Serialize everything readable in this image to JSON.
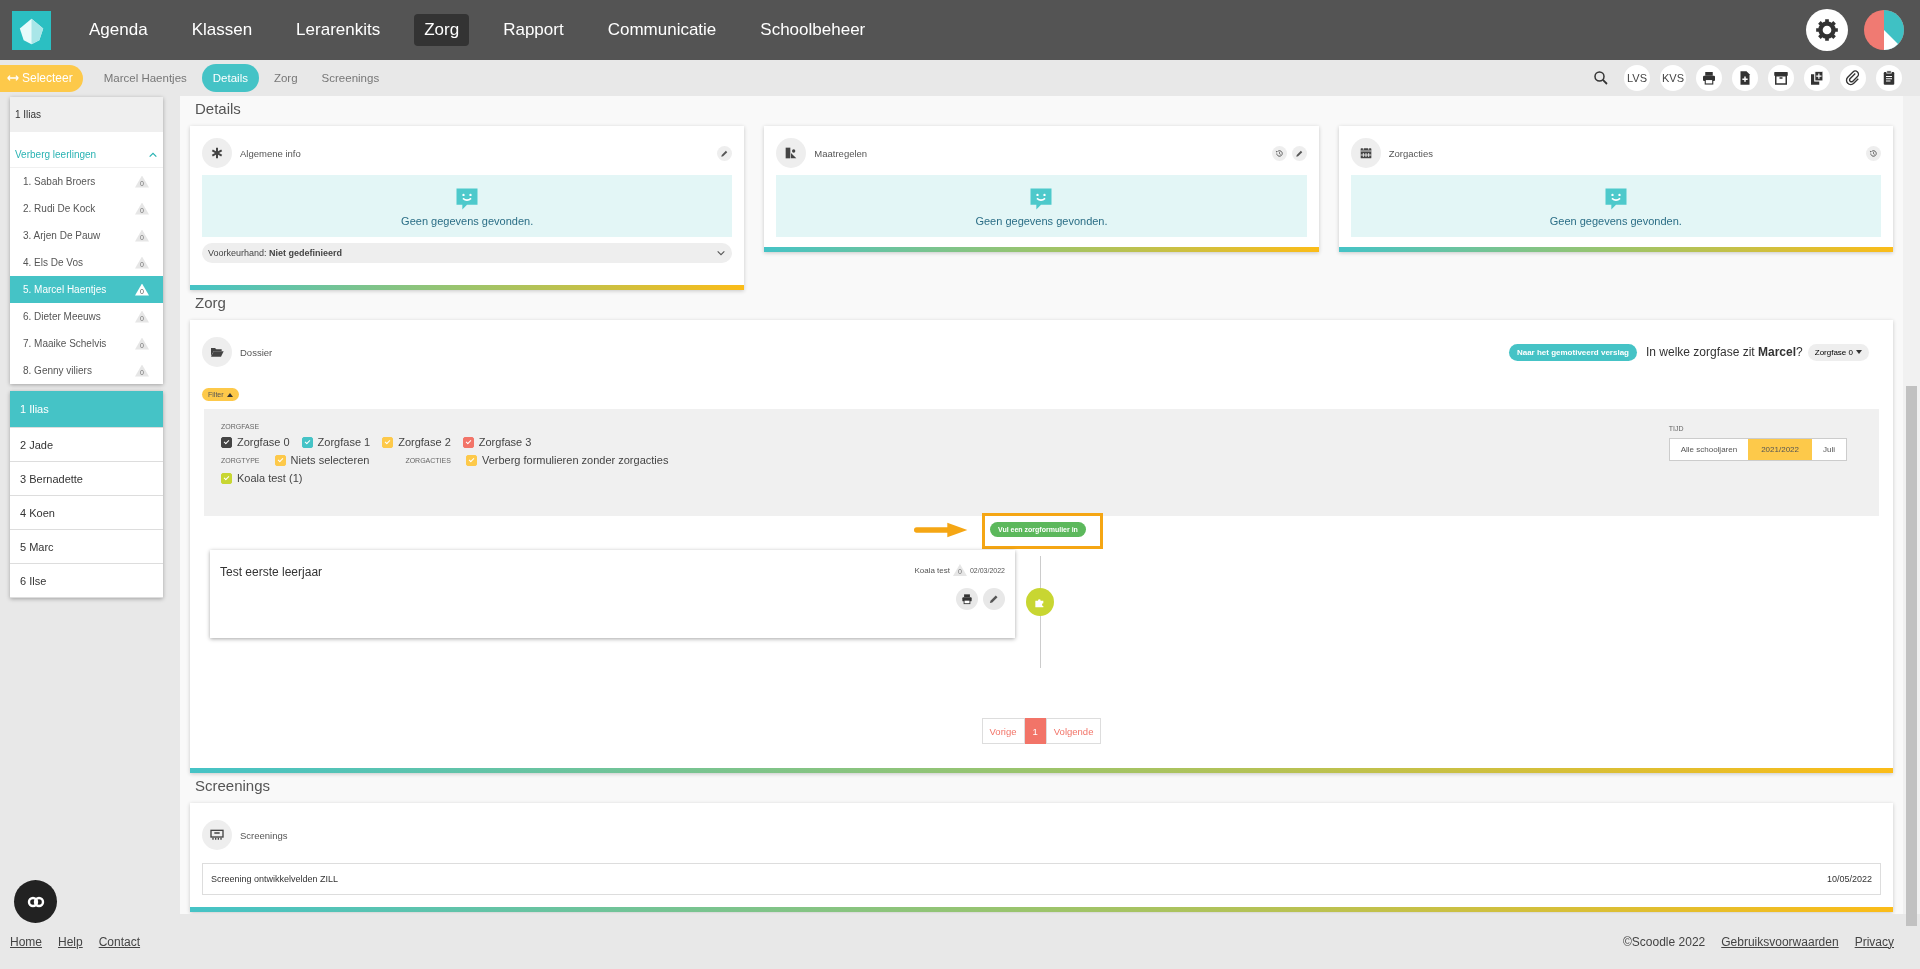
{
  "nav": {
    "items": [
      {
        "label": "Agenda",
        "selected": false
      },
      {
        "label": "Klassen",
        "selected": false
      },
      {
        "label": "Lerarenkits",
        "selected": false
      },
      {
        "label": "Zorg",
        "selected": true
      },
      {
        "label": "Rapport",
        "selected": false
      },
      {
        "label": "Communicatie",
        "selected": false
      },
      {
        "label": "Schoolbeheer",
        "selected": false
      }
    ]
  },
  "subnav": {
    "select_button": "Selecteer",
    "student": "Marcel Haentjes",
    "tabs": [
      {
        "label": "Details",
        "selected": true
      },
      {
        "label": "Zorg",
        "selected": false
      },
      {
        "label": "Screenings",
        "selected": false
      }
    ],
    "tools": [
      {
        "kind": "search"
      },
      {
        "kind": "text",
        "label": "LVS"
      },
      {
        "kind": "text",
        "label": "KVS"
      },
      {
        "kind": "print"
      },
      {
        "kind": "file"
      },
      {
        "kind": "archive"
      },
      {
        "kind": "copy"
      },
      {
        "kind": "paperclip"
      },
      {
        "kind": "clipboard"
      }
    ]
  },
  "sidebar": {
    "class_header": "1 Ilias",
    "toggle": "Verberg leerlingen",
    "expanded": true,
    "students": [
      {
        "name": "1. Sabah Broers",
        "count": "0",
        "selected": false
      },
      {
        "name": "2. Rudi De Kock",
        "count": "0",
        "selected": false
      },
      {
        "name": "3. Arjen De Pauw",
        "count": "0",
        "selected": false
      },
      {
        "name": "4. Els De Vos",
        "count": "0",
        "selected": false
      },
      {
        "name": "5. Marcel Haentjes",
        "count": "0",
        "selected": true
      },
      {
        "name": "6. Dieter Meeuws",
        "count": "0",
        "selected": false
      },
      {
        "name": "7. Maaike Schelvis",
        "count": "0",
        "selected": false
      },
      {
        "name": "8. Genny viliers",
        "count": "0",
        "selected": false
      }
    ],
    "classes": [
      {
        "label": "1 Ilias",
        "selected": true
      },
      {
        "label": "2 Jade",
        "selected": false
      },
      {
        "label": "3 Bernadette",
        "selected": false
      },
      {
        "label": "4 Koen",
        "selected": false
      },
      {
        "label": "5 Marc",
        "selected": false
      },
      {
        "label": "6 Ilse",
        "selected": false
      }
    ]
  },
  "details": {
    "heading": "Details",
    "cards": [
      {
        "title": "Algemene info",
        "kind": "info",
        "actions": [
          {
            "kind": "edit"
          }
        ],
        "empty": "Geen gegevens gevonden.",
        "preference": "Voorkeurhand: **Niet gedefinieerd**"
      },
      {
        "title": "Maatregelen",
        "kind": "measures",
        "actions": [
          {
            "kind": "history"
          },
          {
            "kind": "edit"
          }
        ],
        "empty": "Geen gegevens gevonden."
      },
      {
        "title": "Zorgacties",
        "kind": "calendar",
        "actions": [
          {
            "kind": "history"
          }
        ],
        "empty": "Geen gegevens gevonden."
      }
    ]
  },
  "zorg": {
    "heading": "Zorg",
    "card_title": "Dossier",
    "report_button": "Naar het gemotiveerd verslag",
    "question": "In welke zorgfase zit **Marcel**?",
    "phase_dropdown": "Zorgfase 0",
    "filter_button": "Filter",
    "filter": {
      "zorgfase_label": "ZORGFASE",
      "phases": [
        {
          "label": "Zorgfase 0",
          "checked": true,
          "color": "#444444"
        },
        {
          "label": "Zorgfase 1",
          "checked": true,
          "color": "#45c3c6"
        },
        {
          "label": "Zorgfase 2",
          "checked": true,
          "color": "#fdc94a"
        },
        {
          "label": "Zorgfase 3",
          "checked": true,
          "color": "#f27468"
        }
      ],
      "zorgtype_label": "ZORGTYPE",
      "zorgtype": [
        {
          "label": "Niets selecteren",
          "checked": true,
          "color": "#fdc94a"
        }
      ],
      "zorgacties_label": "ZORGACTIES",
      "zorgacties": [
        {
          "label": "Verberg formulieren zonder zorgacties",
          "checked": true,
          "color": "#fdc94a"
        }
      ],
      "types": [
        {
          "label": "Koala test (1)",
          "checked": true,
          "color": "#c8d632"
        }
      ],
      "time_label": "TIJD",
      "time_options": [
        {
          "label": "Alle schooljaren",
          "selected": false
        },
        {
          "label": "2021/2022",
          "selected": true
        },
        {
          "label": "Juli",
          "selected": false
        }
      ]
    },
    "add_button": "Vul een zorgformulier in",
    "entries": [
      {
        "title": "Test eerste leerjaar",
        "type": "Koala test",
        "count": "0",
        "date": "02/03/2022"
      }
    ],
    "pagination": {
      "prev": "Vorige",
      "pages": [
        {
          "label": "1",
          "selected": true
        }
      ],
      "next": "Volgende"
    }
  },
  "screenings": {
    "heading": "Screenings",
    "card_title": "Screenings",
    "rows": [
      {
        "name": "Screening ontwikkelvelden ZILL",
        "date": "10/05/2022"
      }
    ]
  },
  "footer": {
    "links": [
      "Home",
      "Help",
      "Contact"
    ],
    "copyright": "©Scoodle 2022",
    "right_links": [
      "Gebruiksvoorwaarden",
      "Privacy"
    ]
  }
}
